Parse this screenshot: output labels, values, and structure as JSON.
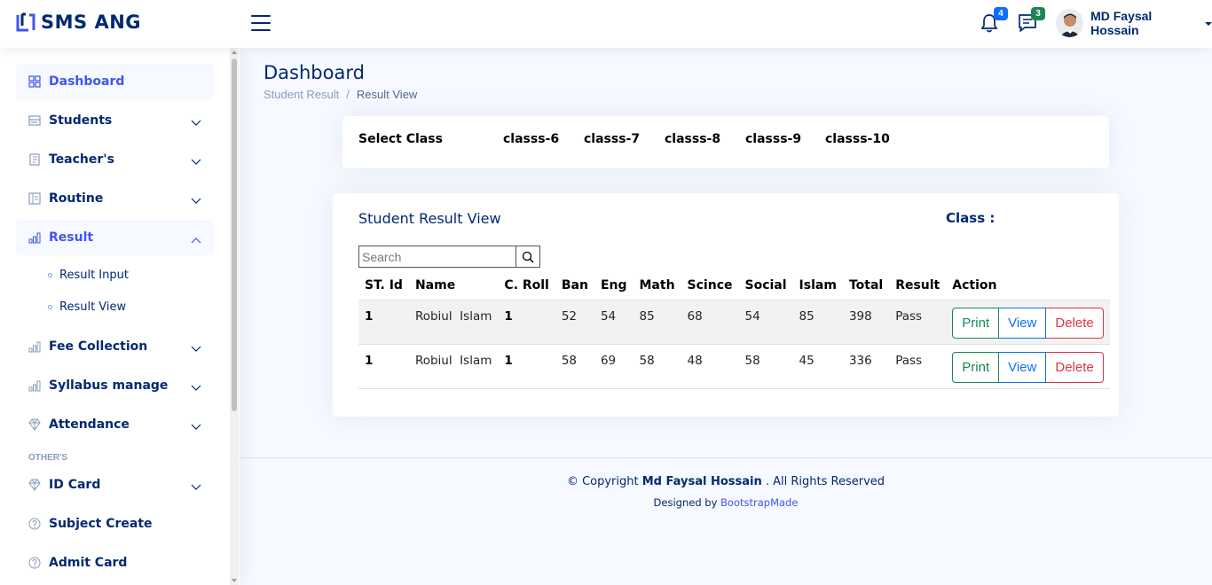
{
  "header": {
    "logo_text": "SMS ANG",
    "notifications_count": "4",
    "messages_count": "3",
    "profile_name": "MD Faysal Hossain",
    "colors": {
      "brand": "#012970",
      "accent": "#4154f1",
      "notif_badge": "#0d6efd",
      "msg_badge": "#198754"
    }
  },
  "sidebar": {
    "items": [
      {
        "label": "Dashboard",
        "icon": "grid-icon"
      },
      {
        "label": "Students",
        "icon": "menu-button-icon"
      },
      {
        "label": "Teacher's",
        "icon": "journal-icon"
      },
      {
        "label": "Routine",
        "icon": "layout-text-icon"
      },
      {
        "label": "Result",
        "icon": "bar-chart-icon"
      },
      {
        "label": "Fee Collection",
        "icon": "bar-chart-icon"
      },
      {
        "label": "Syllabus manage",
        "icon": "bar-chart-icon"
      },
      {
        "label": "Attendance",
        "icon": "gem-icon"
      },
      {
        "label": "ID Card",
        "icon": "gem-icon"
      },
      {
        "label": "Subject Create",
        "icon": "question-circle-icon"
      },
      {
        "label": "Admit Card",
        "icon": "question-circle-icon"
      }
    ],
    "result_sub": [
      "Result Input",
      "Result View"
    ],
    "heading_others": "OTHER'S"
  },
  "main": {
    "page_title": "Dashboard",
    "breadcrumb": [
      "Student Result",
      "Result View"
    ],
    "select_class_label": "Select Class",
    "class_options": [
      "classs-6",
      "classs-7",
      "classs-8",
      "classs-9",
      "classs-10"
    ],
    "card_title": "Student Result View",
    "class_label": "Class :",
    "search_placeholder": "Search",
    "columns": [
      "ST. Id",
      "Name",
      "C. Roll",
      "Ban",
      "Eng",
      "Math",
      "Scince",
      "Social",
      "Islam",
      "Total",
      "Result",
      "Action"
    ],
    "rows": [
      {
        "id": "1",
        "name": "Robiul  Islam",
        "roll": "1",
        "ban": "52",
        "eng": "54",
        "math": "85",
        "scince": "68",
        "social": "54",
        "islam": "85",
        "total": "398",
        "result": "Pass"
      },
      {
        "id": "1",
        "name": "Robiul  Islam",
        "roll": "1",
        "ban": "58",
        "eng": "69",
        "math": "58",
        "scince": "48",
        "social": "58",
        "islam": "45",
        "total": "336",
        "result": "Pass"
      }
    ],
    "actions": {
      "print": "Print",
      "view": "View",
      "delete": "Delete"
    }
  },
  "footer": {
    "copyright_prefix": "© Copyright",
    "copyright_name": "Md Faysal Hossain",
    "copyright_suffix": ". All Rights Reserved",
    "designed_by_prefix": "Designed by",
    "designed_by_link": "BootstrapMade"
  }
}
